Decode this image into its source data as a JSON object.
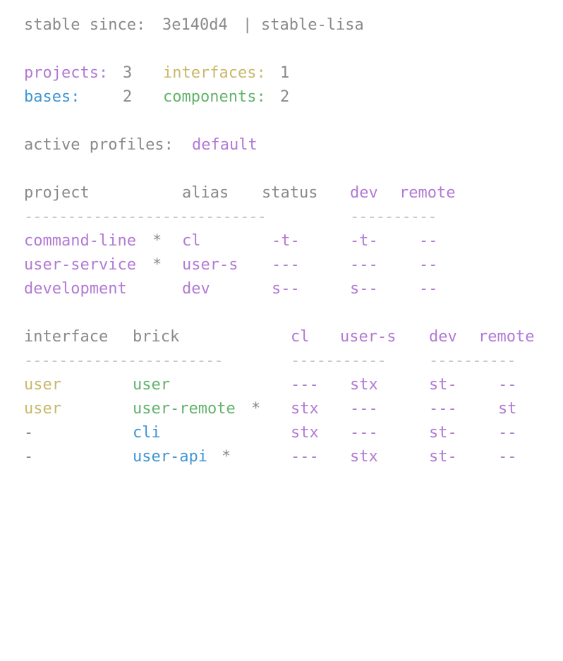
{
  "header": {
    "stable_label": "stable since:",
    "stable_hash": "3e140d4",
    "separator": "|",
    "stable_tag": "stable-lisa"
  },
  "summary": {
    "projects_label": "projects:",
    "projects_value": "3",
    "interfaces_label": "interfaces:",
    "interfaces_value": "1",
    "bases_label": "bases:",
    "bases_value": "2",
    "components_label": "components:",
    "components_value": "2"
  },
  "profiles": {
    "label": "active profiles:",
    "value": "default"
  },
  "projects_table": {
    "headers": {
      "project": "project",
      "alias": "alias",
      "status": "status",
      "dev": "dev",
      "remote": "remote"
    },
    "divider_left": "----------------------------",
    "divider_right": "----------",
    "rows": [
      {
        "name": "command-line",
        "marker": "*",
        "alias": "cl",
        "status": "-t-",
        "dev": "-t-",
        "remote": "--"
      },
      {
        "name": "user-service",
        "marker": "*",
        "alias": "user-s",
        "status": "---",
        "dev": "---",
        "remote": "--"
      },
      {
        "name": "development",
        "marker": "",
        "alias": "dev",
        "status": "s--",
        "dev": "s--",
        "remote": "--"
      }
    ]
  },
  "bricks_table": {
    "headers": {
      "interface": "interface",
      "brick": "brick",
      "cl": "cl",
      "user_s": "user-s",
      "dev": "dev",
      "remote": "remote"
    },
    "divider_left": "-----------------------",
    "divider_mid": "-----------",
    "divider_right": "----------",
    "rows": [
      {
        "interface": "user",
        "brick": "user",
        "marker": "",
        "cl": "---",
        "user_s": "stx",
        "dev": "st-",
        "remote": "--"
      },
      {
        "interface": "user",
        "brick": "user-remote",
        "marker": "*",
        "cl": "stx",
        "user_s": "---",
        "dev": "---",
        "remote": "st"
      },
      {
        "interface": "-",
        "brick": "cli",
        "marker": "",
        "cl": "stx",
        "user_s": "---",
        "dev": "st-",
        "remote": "--"
      },
      {
        "interface": "-",
        "brick": "user-api",
        "marker": "*",
        "cl": "---",
        "user_s": "stx",
        "dev": "st-",
        "remote": "--"
      }
    ]
  },
  "colors": {
    "gray": "#8a8a8a",
    "project": "#b27ad4",
    "interface": "#c9b86a",
    "base": "#3f95d5",
    "component": "#62b36c"
  }
}
